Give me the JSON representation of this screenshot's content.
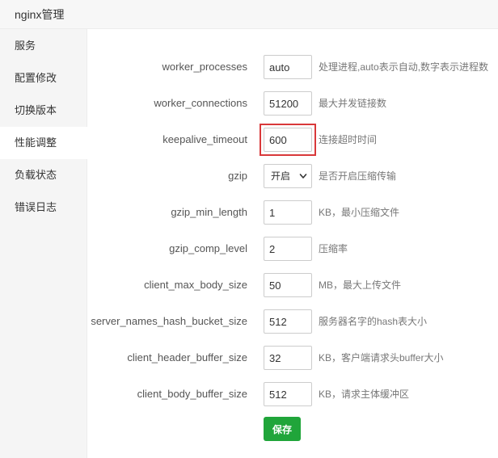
{
  "header": {
    "title": "nginx管理"
  },
  "sidebar": {
    "items": [
      {
        "label": "服务"
      },
      {
        "label": "配置修改"
      },
      {
        "label": "切换版本"
      },
      {
        "label": "性能调整"
      },
      {
        "label": "负载状态"
      },
      {
        "label": "错误日志"
      }
    ],
    "active_index": 3
  },
  "form": {
    "fields": [
      {
        "name": "worker_processes",
        "value": "auto",
        "hint": "处理进程,auto表示自动,数字表示进程数"
      },
      {
        "name": "worker_connections",
        "value": "51200",
        "hint": "最大并发链接数"
      },
      {
        "name": "keepalive_timeout",
        "value": "600",
        "hint": "连接超时时间",
        "highlighted": true
      },
      {
        "name": "gzip",
        "value": "开启",
        "hint": "是否开启压缩传输",
        "type": "select"
      },
      {
        "name": "gzip_min_length",
        "value": "1",
        "hint": "KB，最小压缩文件"
      },
      {
        "name": "gzip_comp_level",
        "value": "2",
        "hint": "压缩率"
      },
      {
        "name": "client_max_body_size",
        "value": "50",
        "hint": "MB，最大上传文件"
      },
      {
        "name": "server_names_hash_bucket_size",
        "value": "512",
        "hint": "服务器名字的hash表大小"
      },
      {
        "name": "client_header_buffer_size",
        "value": "32",
        "hint": "KB，客户端请求头buffer大小"
      },
      {
        "name": "client_body_buffer_size",
        "value": "512",
        "hint": "KB，请求主体缓冲区"
      }
    ],
    "save_label": "保存"
  },
  "colors": {
    "accent_green": "#20a53a",
    "highlight_red": "#d9383a",
    "sidebar_bg": "#f5f5f5"
  },
  "icons": {
    "select_arrow": "chevron-down-icon"
  }
}
